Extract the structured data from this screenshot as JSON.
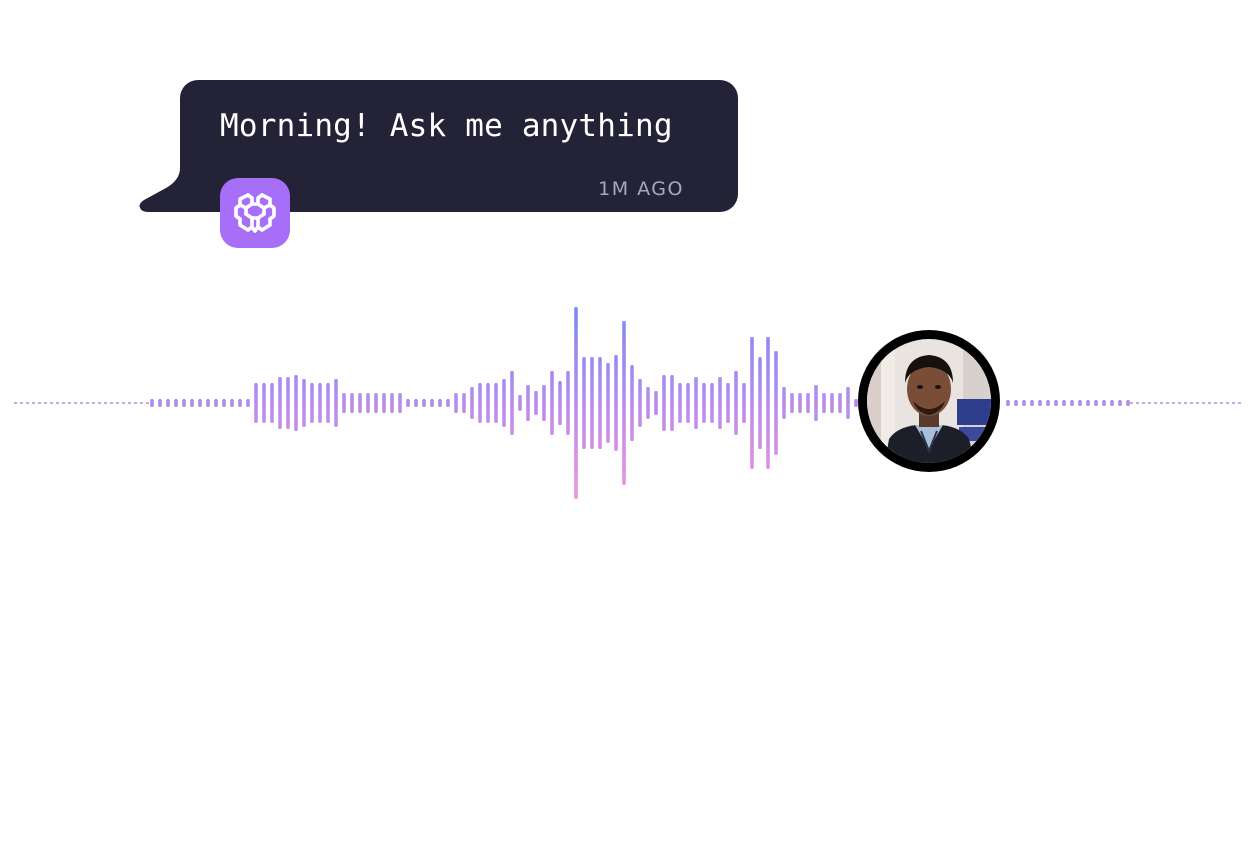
{
  "message": {
    "text": "Morning! Ask me anything",
    "time": "1M AGO"
  },
  "assistant": {
    "avatar_icon": "brain-icon",
    "accent": "#a76ef7"
  },
  "waveform": {
    "state": "listening",
    "gradient": [
      "#7b88f7",
      "#f393dd"
    ],
    "dashed_line": "#b08be8"
  },
  "user": {
    "avatar": "user-photo-avatar"
  }
}
